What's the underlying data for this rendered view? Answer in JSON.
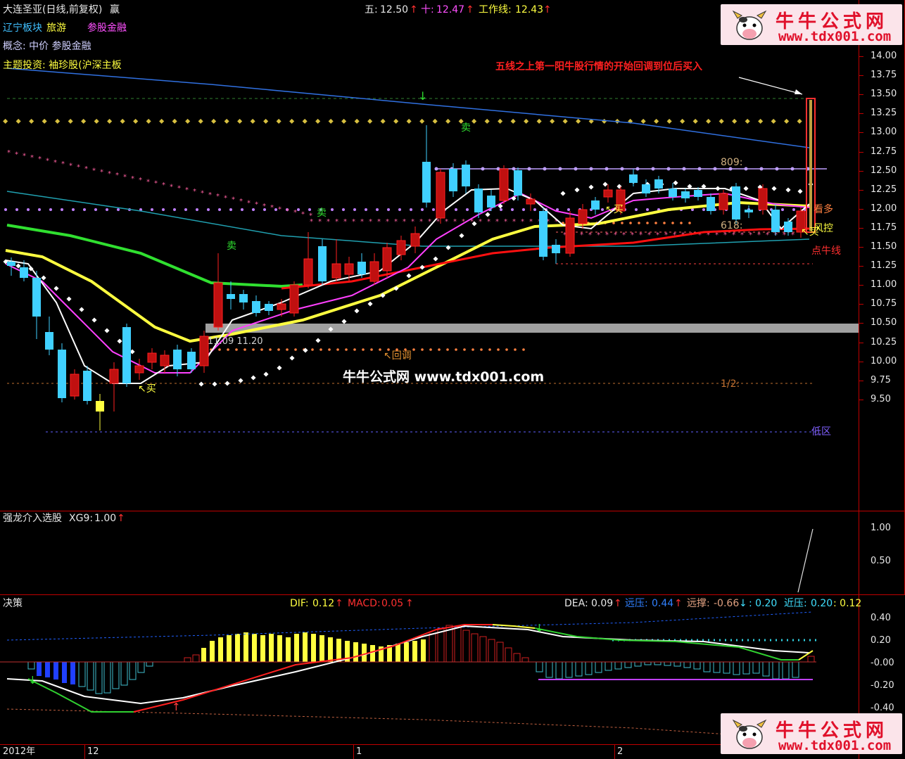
{
  "header": {
    "stock_title": "大连圣亚(日线,前复权)",
    "title_mark": "赢",
    "line5_label": "五:",
    "line5_value": "12.50",
    "line10_label": "十:",
    "line10_value": "12.47",
    "work_label": "工作线:",
    "work_value": "12.43",
    "up_arrow": "↑",
    "sector_region": "辽宁板块",
    "sector_industry": "旅游",
    "sector_finance": "参股金融",
    "concept": "概念: 中价 参股金融",
    "theme": "主题投资: 袖珍股(沪深主板"
  },
  "annotations": {
    "top_note": "五线之上第一阳牛股行情的开始回调到位后买入",
    "sell": "卖",
    "buy": "买",
    "buy_arrow": "↖买",
    "pullback": "↖回调",
    "level_809": "809:",
    "level_618": "618:",
    "level_half": "1/2:",
    "low_zone": "低区",
    "look_long": "看多",
    "wind_control": "风控",
    "bull_line": "点牛线",
    "price_pair": "11.09 11.20"
  },
  "watermark": "牛牛公式网 www.tdx001.com",
  "logo": {
    "title": "牛牛公式网",
    "url": "www.tdx001.com"
  },
  "price_axis": [
    "14.00",
    "13.75",
    "13.50",
    "13.25",
    "13.00",
    "12.75",
    "12.50",
    "12.25",
    "12.00",
    "11.75",
    "11.50",
    "11.25",
    "11.00",
    "10.75",
    "10.50",
    "10.25",
    "10.00",
    "9.75",
    "9.50"
  ],
  "panel2": {
    "name": "强龙介入选股",
    "xg_label": "XG9:",
    "xg_value": "1.00",
    "axis": [
      "1.00",
      "0.50"
    ]
  },
  "panel3": {
    "name": "决策",
    "dif_label": "DIF:",
    "dif_value": "0.12",
    "macd_label": "MACD:",
    "macd_value": "0.05",
    "dea_label": "DEA:",
    "dea_value": "0.09",
    "far_press_label": "远压:",
    "far_press_value": "0.44",
    "far_support_label": "远撑:",
    "far_support_value": "-0.66",
    "down_arrow": "↓",
    "near_extra": ": 0.20",
    "near_press_label": "近压:",
    "near_press_value": "0.20",
    "tail_value": ": 0.12",
    "axis": [
      "0.40",
      "0.20",
      "-0.00",
      "-0.20",
      "-0.40"
    ]
  },
  "time_axis": {
    "year": "2012年",
    "m12": "12",
    "m1": "1",
    "m2": "2"
  },
  "colors": {
    "up": "#ff2020",
    "down": "#40d0ff",
    "yellow": "#ffff40",
    "green": "#30e030",
    "magenta": "#ff40ff",
    "red_line": "#ff1010"
  }
}
